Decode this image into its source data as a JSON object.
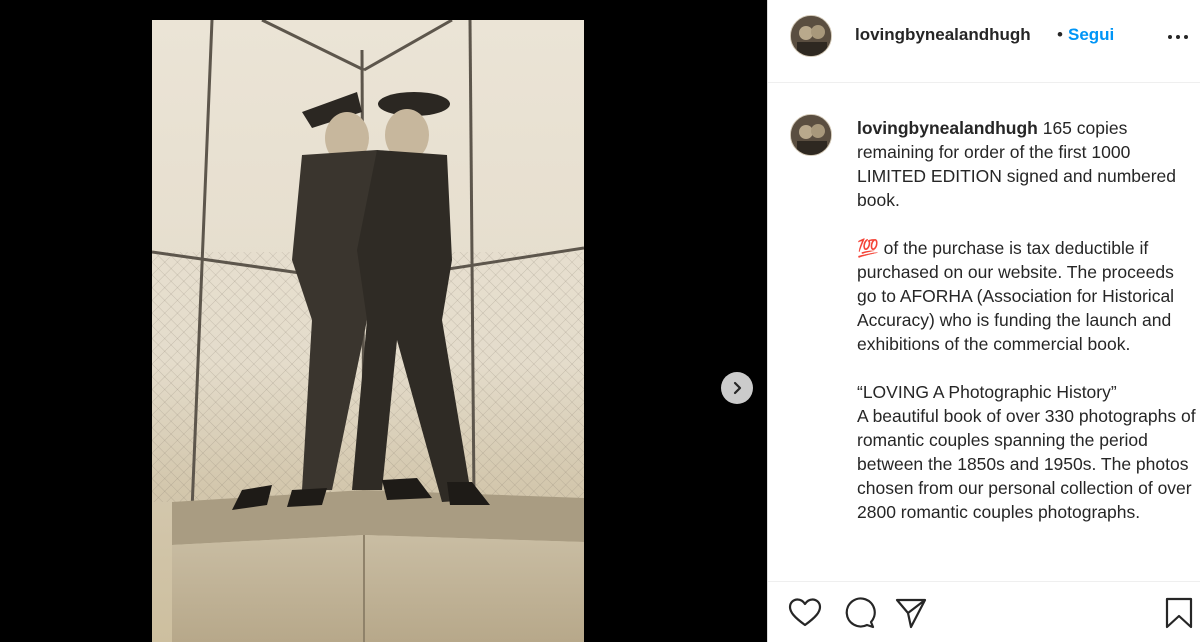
{
  "post": {
    "username": "lovingbynealandhugh",
    "separator": "•",
    "follow_label": "Segui",
    "more_icon": "more-dots-icon"
  },
  "caption": {
    "username": "lovingbynealandhugh",
    "text": " 165 copies remaining for order of the first 1000 LIMITED EDITION signed and numbered book.\n\n💯 of the purchase is tax deductible if purchased on our website. The proceeds go to AFORHA (Association for Historical Accuracy) who is funding the launch and exhibitions of the commercial book.\n\n“LOVING A Photographic History”\nA beautiful book of over 330 photographs of romantic couples spanning the period between the 1850s and 1950s. The photos chosen from our personal collection of over 2800 romantic couples photographs."
  },
  "actions": {
    "icons": [
      "heart-icon",
      "comment-icon",
      "share-icon",
      "bookmark-icon"
    ]
  },
  "colors": {
    "accent": "#0095f6",
    "text": "#262626",
    "media_background": "#000000"
  }
}
